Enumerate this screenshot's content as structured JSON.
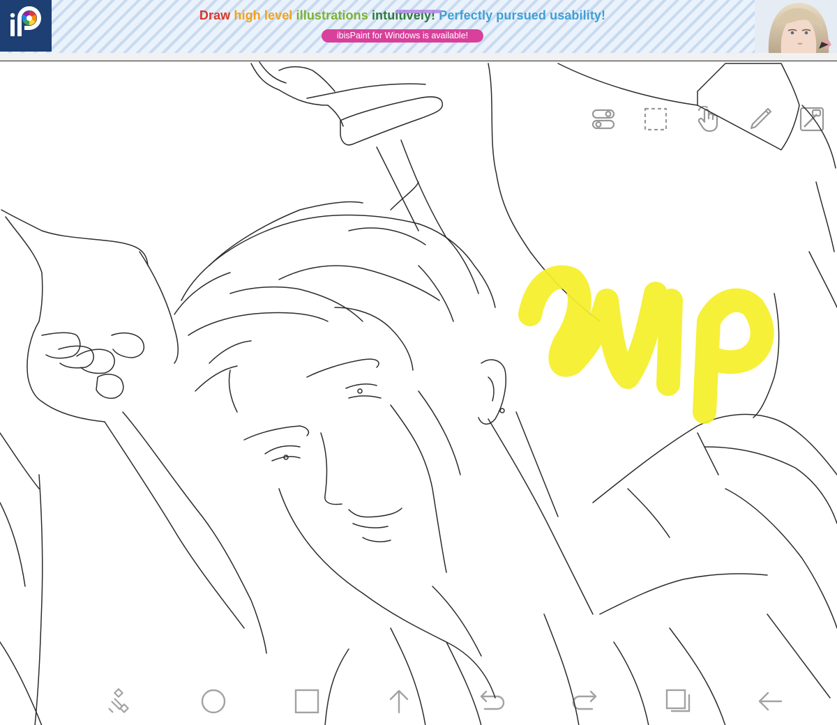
{
  "ad_banner": {
    "headline": [
      {
        "text": "Draw ",
        "color": "#d9372a"
      },
      {
        "text": "high level ",
        "color": "#f0a21c"
      },
      {
        "text": "illustrations ",
        "color": "#7cb232"
      },
      {
        "text": "intuitively! ",
        "color": "#2f7a3c"
      },
      {
        "text": "Perfectly pursued usability!",
        "color": "#3f9fd6"
      }
    ],
    "cta_label": "ibisPaint for Windows is available!",
    "logo_icon": "ibispaint-logo-icon",
    "character_image": "ad-character-portrait",
    "colors": {
      "stripe_light": "#eaf2fb",
      "stripe_dark": "#c9daf0",
      "logo_bg": "#1d3f73",
      "cta_bg": "#d8409b"
    }
  },
  "canvas": {
    "overlay_text": "WIP",
    "overlay_color": "#f5ef2a",
    "line_color": "#2b2b2b"
  },
  "top_toolbar": [
    {
      "name": "toggle-icon",
      "label": "Toggle"
    },
    {
      "name": "selection-icon",
      "label": "Selection"
    },
    {
      "name": "touch-hand-icon",
      "label": "Touch"
    },
    {
      "name": "brush-icon",
      "label": "Brush"
    },
    {
      "name": "color-swatch-icon",
      "label": "Color"
    }
  ],
  "bottom_toolbar": [
    {
      "name": "transform-icon",
      "label": "Transform"
    },
    {
      "name": "circle-icon",
      "label": "Ellipse"
    },
    {
      "name": "square-icon",
      "label": "Rectangle"
    },
    {
      "name": "arrow-up-icon",
      "label": "Up"
    },
    {
      "name": "undo-icon",
      "label": "Undo"
    },
    {
      "name": "redo-icon",
      "label": "Redo"
    },
    {
      "name": "layers-icon",
      "label": "Layers"
    },
    {
      "name": "back-arrow-icon",
      "label": "Back"
    }
  ]
}
